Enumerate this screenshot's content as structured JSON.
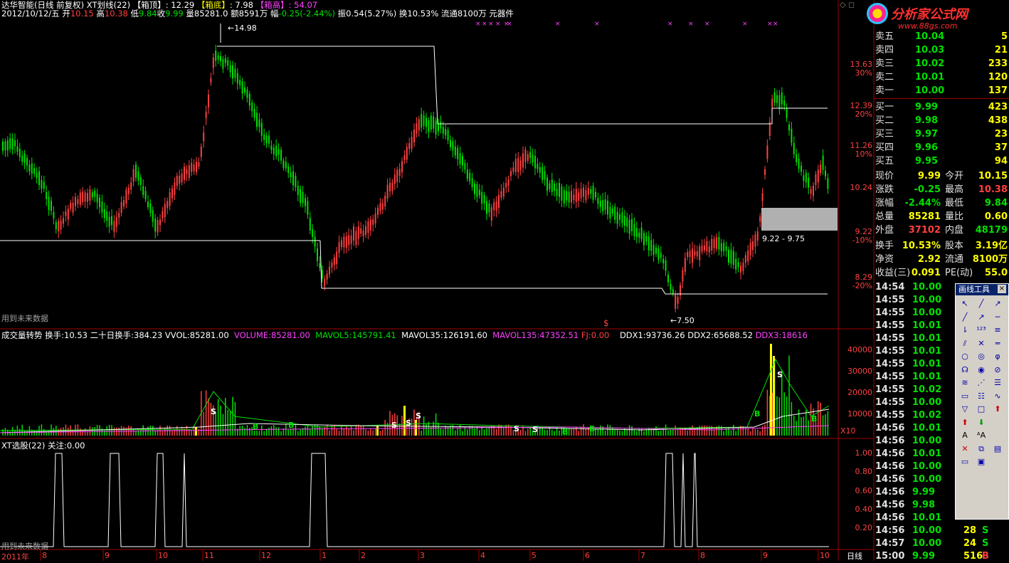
{
  "header": {
    "title": "达华智能(日线 前复权) XT划线(22)",
    "box_top_label": "【箱顶】",
    "box_top_value": ": 12.29",
    "box_bottom_label": "【箱底】",
    "box_bottom_value": ": 7.98",
    "box_high_label": "【箱高】",
    "box_high_value": ": 54.07"
  },
  "quote_line": {
    "date": "2012/10/12/五",
    "open_label": "开",
    "open": "10.15",
    "high_label": "高",
    "high": "10.38",
    "low_label": "低",
    "low": "9.84",
    "close_label": "收",
    "close": "9.99",
    "vol_label": "量",
    "vol": "85281.0",
    "amt_label": "额",
    "amt": "8591万",
    "chg_label": "幅",
    "chg": "-0.25(-2.44%)",
    "amp_label": "振",
    "amp": "0.54(5.27%)",
    "turn_label": "换",
    "turn": "10.53%",
    "float_label": "流通",
    "float": "8100万",
    "extra": "元器件"
  },
  "brand": {
    "name": "分析家公式网",
    "url": "www.88gs.com"
  },
  "price_axis": [
    {
      "v": "13.63",
      "p": "30%"
    },
    {
      "v": "12.39",
      "p": "20%"
    },
    {
      "v": "11.26",
      "p": "10%"
    },
    {
      "v": "10.24",
      "p": ""
    },
    {
      "v": "9.22",
      "p": "-10%"
    },
    {
      "v": "8.29",
      "p": "-20%"
    }
  ],
  "annotations": {
    "high_mark": "14.98",
    "low_mark": "7.50",
    "range_label": "9.22 - 9.75",
    "future_note": "用到未来数据",
    "signal_s": "$"
  },
  "vol_header": {
    "name": "成交量转势",
    "turn_label": "换手:",
    "turn": "10.53",
    "turn20_label": "二十日换手:",
    "turn20": "384.23",
    "vvol_label": "VVOL:",
    "vvol": "85281.00",
    "volume_label": "VOLUME:",
    "volume": "85281.00",
    "mavol5_label": "MAVOL5:",
    "mavol5": "145791.41",
    "mavol35_label": "MAVOL35:",
    "mavol35": "126191.60",
    "mavol135_label": "MAVOL135:",
    "mavol135": "47352.51",
    "fj_label": "FJ:",
    "fj": "0.00",
    "ddx1_label": "DDX1:",
    "ddx1": "93736.26",
    "ddx2_label": "DDX2:",
    "ddx2": "65688.52",
    "ddx3_label": "DDX3:",
    "ddx3": "18616"
  },
  "vol_axis": [
    "40000",
    "30000",
    "20000",
    "10000"
  ],
  "vol_unit": "X10",
  "xt_header": {
    "name": "XT选股(22)",
    "focus_label": "关注:",
    "focus": "0.00"
  },
  "xt_axis": [
    "1.00",
    "0.80",
    "0.60",
    "0.40",
    "0.20"
  ],
  "date_axis": {
    "year": "2011年",
    "months": [
      "8",
      "9",
      "10",
      "11",
      "12",
      "1",
      "2",
      "3",
      "4",
      "5",
      "6",
      "7",
      "8",
      "9",
      "10"
    ],
    "period": "日线"
  },
  "order_book": [
    {
      "label": "卖五",
      "price": "10.04",
      "vol": "5"
    },
    {
      "label": "卖四",
      "price": "10.03",
      "vol": "21"
    },
    {
      "label": "卖三",
      "price": "10.02",
      "vol": "233"
    },
    {
      "label": "卖二",
      "price": "10.01",
      "vol": "120"
    },
    {
      "label": "卖一",
      "price": "10.00",
      "vol": "137"
    },
    {
      "label": "买一",
      "price": "9.99",
      "vol": "423"
    },
    {
      "label": "买二",
      "price": "9.98",
      "vol": "438"
    },
    {
      "label": "买三",
      "price": "9.97",
      "vol": "23"
    },
    {
      "label": "买四",
      "price": "9.96",
      "vol": "37"
    },
    {
      "label": "买五",
      "price": "9.95",
      "vol": "94"
    }
  ],
  "stats": [
    {
      "l1": "现价",
      "v1": "9.99",
      "l2": "今开",
      "v2": "10.15"
    },
    {
      "l1": "涨跌",
      "v1": "-0.25",
      "l2": "最高",
      "v2": "10.38"
    },
    {
      "l1": "涨幅",
      "v1": "-2.44%",
      "l2": "最低",
      "v2": "9.84"
    },
    {
      "l1": "总量",
      "v1": "85281",
      "l2": "量比",
      "v2": "0.60"
    },
    {
      "l1": "外盘",
      "v1": "37102",
      "l2": "内盘",
      "v2": "48179"
    },
    {
      "l1": "换手",
      "v1": "10.53%",
      "l2": "股本",
      "v2": "3.19亿"
    },
    {
      "l1": "净资",
      "v1": "2.92",
      "l2": "流通",
      "v2": "8100万"
    },
    {
      "l1": "收益(三)",
      "v1": "0.091",
      "l2": "PE(动)",
      "v2": "55.0"
    }
  ],
  "ticks": [
    {
      "t": "14:54",
      "p": "10.00",
      "v": "",
      "d": ""
    },
    {
      "t": "14:55",
      "p": "10.00",
      "v": "",
      "d": ""
    },
    {
      "t": "14:55",
      "p": "10.00",
      "v": "",
      "d": ""
    },
    {
      "t": "14:55",
      "p": "10.01",
      "v": "",
      "d": ""
    },
    {
      "t": "14:55",
      "p": "10.01",
      "v": "",
      "d": ""
    },
    {
      "t": "14:55",
      "p": "10.01",
      "v": "",
      "d": ""
    },
    {
      "t": "14:55",
      "p": "10.01",
      "v": "",
      "d": ""
    },
    {
      "t": "14:55",
      "p": "10.01",
      "v": "",
      "d": ""
    },
    {
      "t": "14:55",
      "p": "10.02",
      "v": "",
      "d": ""
    },
    {
      "t": "14:55",
      "p": "10.00",
      "v": "",
      "d": ""
    },
    {
      "t": "14:55",
      "p": "10.02",
      "v": "",
      "d": ""
    },
    {
      "t": "14:56",
      "p": "10.01",
      "v": "",
      "d": ""
    },
    {
      "t": "14:56",
      "p": "10.00",
      "v": "",
      "d": ""
    },
    {
      "t": "14:56",
      "p": "10.01",
      "v": "",
      "d": ""
    },
    {
      "t": "14:56",
      "p": "10.00",
      "v": "",
      "d": ""
    },
    {
      "t": "14:56",
      "p": "10.00",
      "v": "",
      "d": ""
    },
    {
      "t": "14:56",
      "p": "9.99",
      "v": "",
      "d": ""
    },
    {
      "t": "14:56",
      "p": "9.98",
      "v": "",
      "d": ""
    },
    {
      "t": "14:56",
      "p": "10.01",
      "v": "",
      "d": ""
    },
    {
      "t": "14:56",
      "p": "10.00",
      "v": "28",
      "d": "S"
    },
    {
      "t": "14:57",
      "p": "10.00",
      "v": "24",
      "d": "S"
    },
    {
      "t": "15:00",
      "p": "9.99",
      "v": "516",
      "d": "B"
    }
  ],
  "toolbox": {
    "title": "画线工具",
    "tools": [
      "arrow-tool",
      "line-tool",
      "ray-tool",
      "segment-tool",
      "ext-line-tool",
      "hline-tool",
      "vline-tool",
      "price-mark-tool",
      "channel-tool",
      "parallel-tool",
      "cross-tool",
      "double-line-tool",
      "circle-tool",
      "ellipse-tool",
      "fib-tool",
      "gann-tool",
      "cycle-tool",
      "speed-tool",
      "regression-tool",
      "fan-tool",
      "golden-tool",
      "box-tool",
      "period-tool",
      "wave-tool",
      "triangle-tool",
      "rect-tool",
      "sell-mark-tool",
      "up-arrow-tool",
      "down-arrow-tool",
      "blank-tool",
      "text-tool",
      "text2-tool",
      "blank2-tool",
      "delete-tool",
      "copy-tool",
      "list-tool",
      "ruler-tool",
      "save-tool"
    ]
  },
  "colors": {
    "up": "#ff4040",
    "down": "#00e000",
    "box": "#ffffff",
    "mavol135": "#ff40ff",
    "highlight": "#b0b0b0"
  }
}
